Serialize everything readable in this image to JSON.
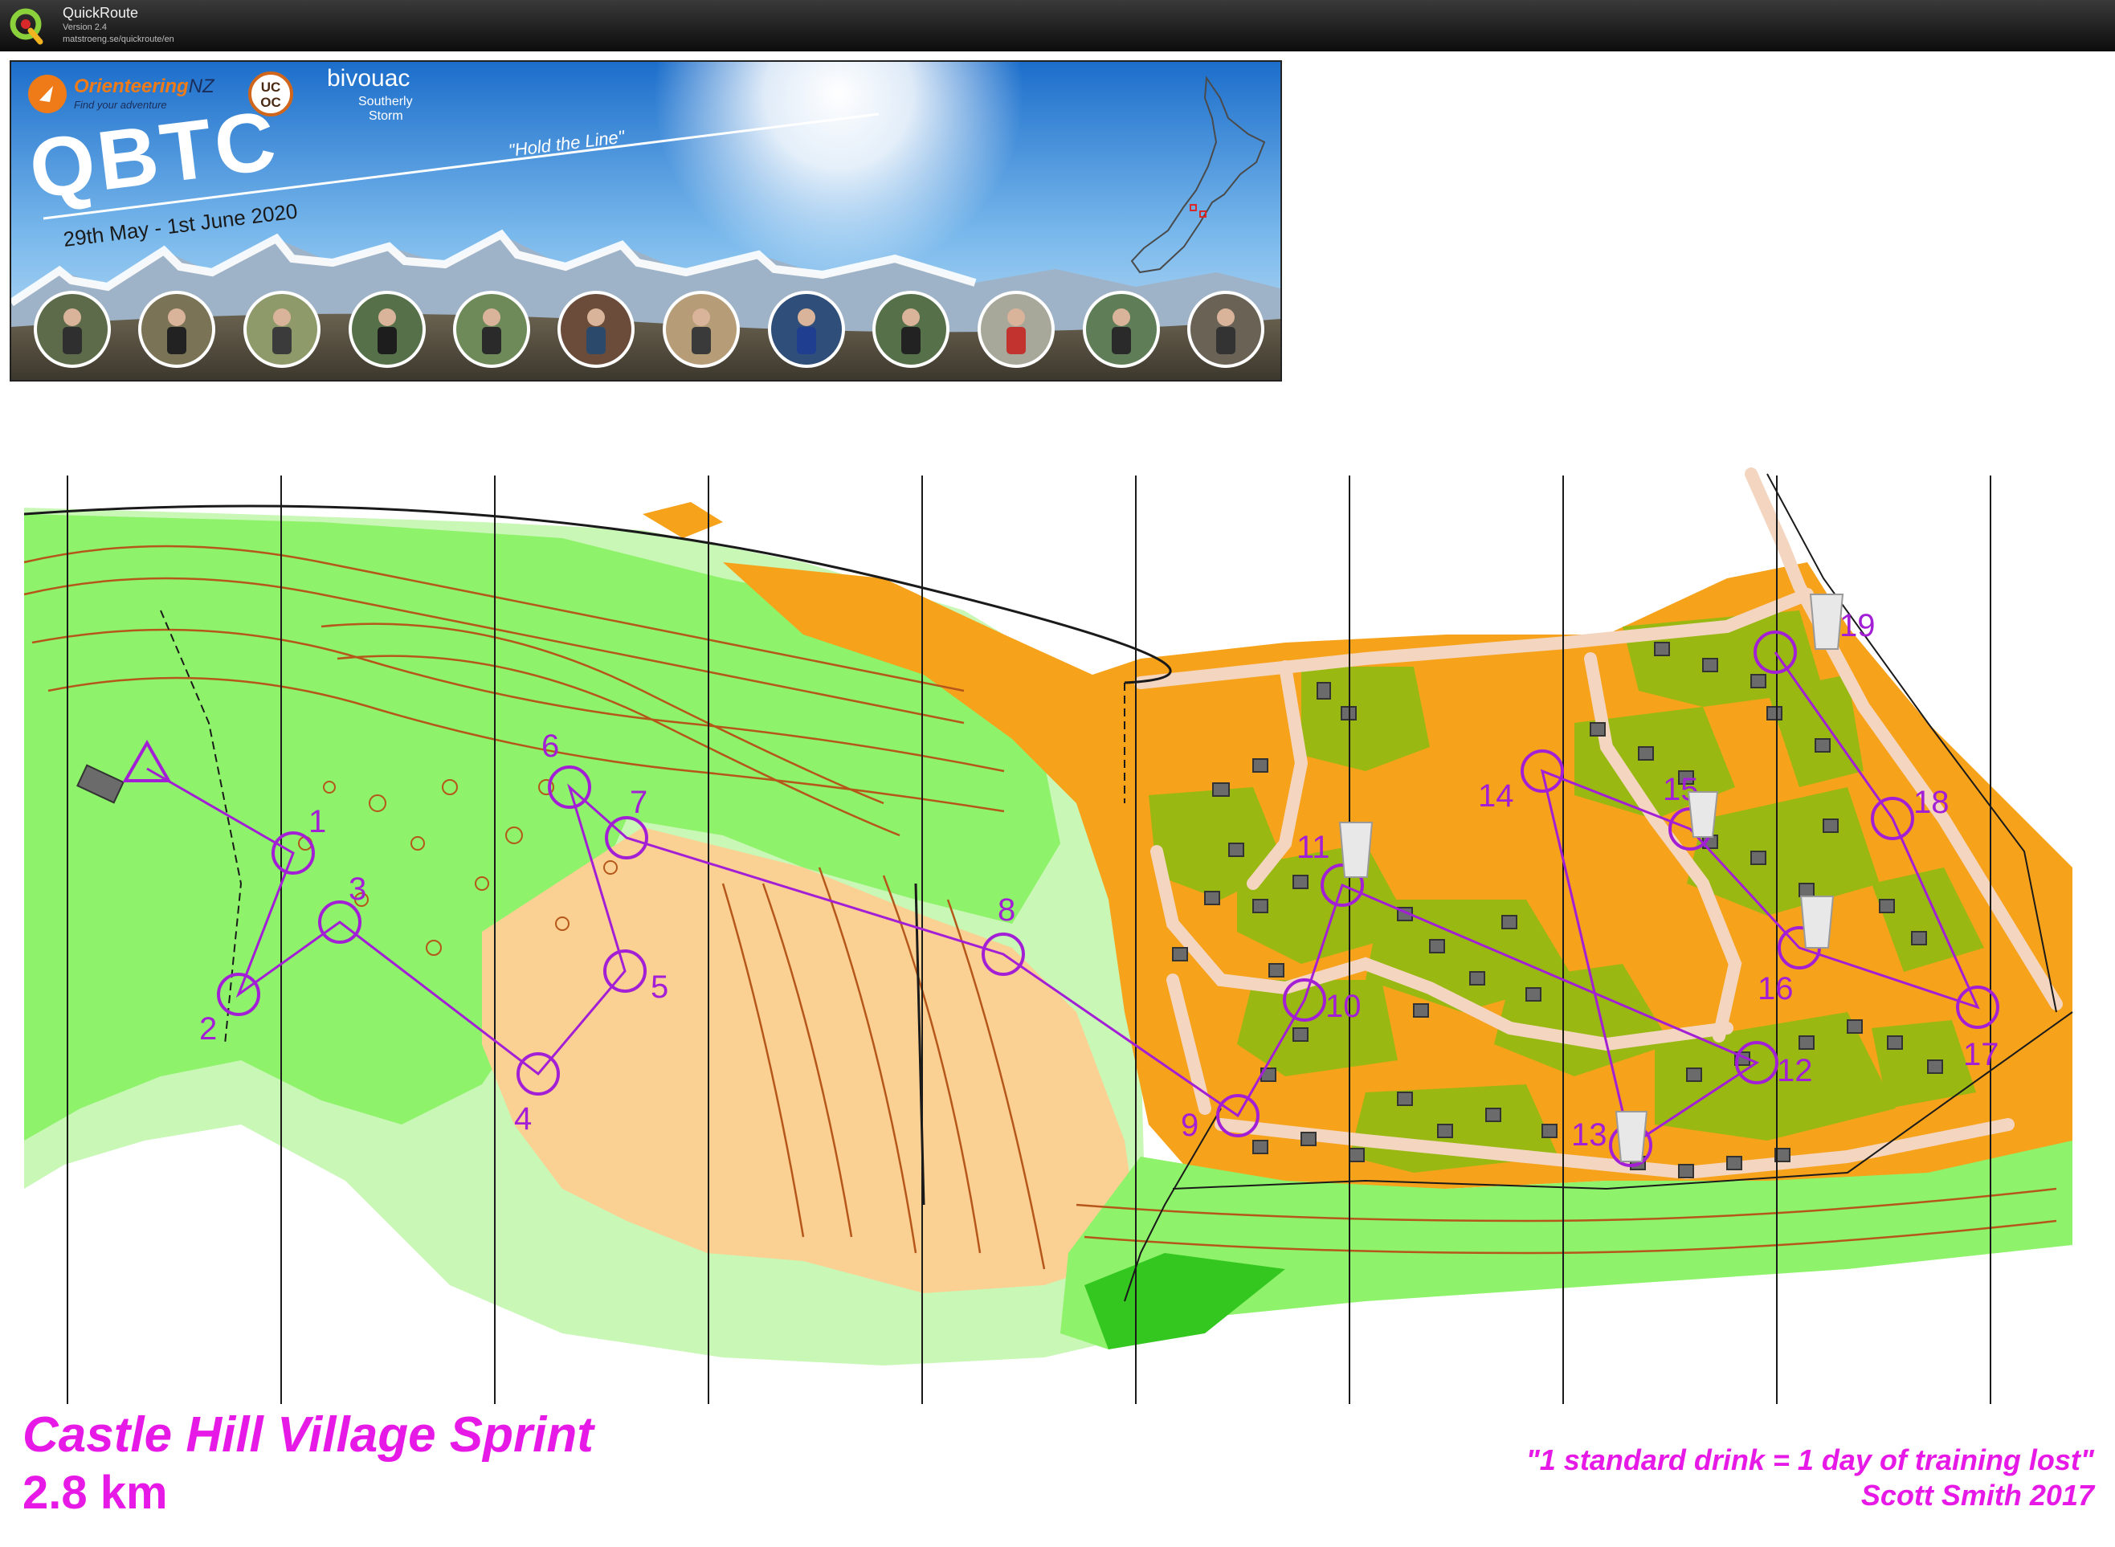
{
  "app": {
    "name": "QuickRoute",
    "version": "Version 2.4",
    "url": "matstroeng.se/quickroute/en"
  },
  "banner": {
    "sponsors": [
      "Orienteering NZ",
      "Find your adventure",
      "UC OC",
      "bivouac",
      "Southerly Storm"
    ],
    "event_title": "QBTC",
    "slogan": "\"Hold the Line\"",
    "dates": "29th May - 1st June 2020",
    "runner_photo_count": 12,
    "colors": {
      "sky": "#3f8fd8",
      "mountain_snow": "#ffffff",
      "frame": "#222222"
    }
  },
  "map": {
    "title": "Castle Hill Village Sprint",
    "distance": "2.8 km",
    "quote": "\"1 standard drink = 1 day of training lost\"",
    "attribution": "Scott Smith 2017",
    "colors": {
      "course": "#a31fd6",
      "text": "#e619e6",
      "open_land": "#f7a21b",
      "rough_open": "#fbd193",
      "forest_green": "#8ef26a",
      "light_green": "#c8f7b6",
      "olive": "#9ab812",
      "building": "#6b6b6b",
      "road": "#f3d5c0",
      "contour": "#b5571a"
    },
    "course": {
      "start_icon": "start-triangle",
      "controls": [
        {
          "number": "1"
        },
        {
          "number": "2"
        },
        {
          "number": "3"
        },
        {
          "number": "4"
        },
        {
          "number": "5"
        },
        {
          "number": "6"
        },
        {
          "number": "7"
        },
        {
          "number": "8"
        },
        {
          "number": "9"
        },
        {
          "number": "10"
        },
        {
          "number": "11"
        },
        {
          "number": "12"
        },
        {
          "number": "13"
        },
        {
          "number": "14"
        },
        {
          "number": "15"
        },
        {
          "number": "16"
        },
        {
          "number": "17"
        },
        {
          "number": "18"
        },
        {
          "number": "19"
        }
      ],
      "drink_controls": [
        "11",
        "13",
        "15",
        "16",
        "19"
      ]
    }
  }
}
